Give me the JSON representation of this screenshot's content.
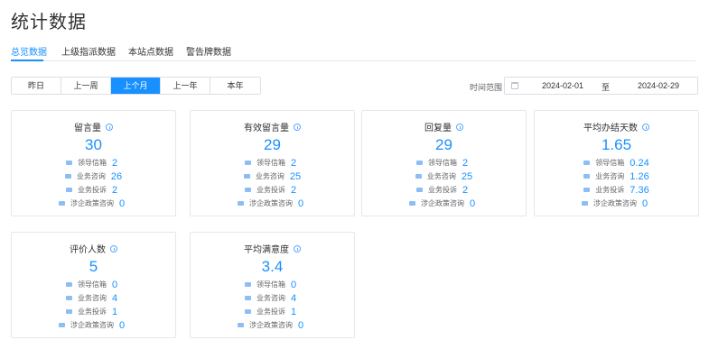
{
  "page_title": "统计数据",
  "tabs": [
    {
      "label": "总览数据",
      "active": true
    },
    {
      "label": "上级指派数据",
      "active": false
    },
    {
      "label": "本站点数据",
      "active": false
    },
    {
      "label": "警告牌数据",
      "active": false
    }
  ],
  "range_buttons": [
    "昨日",
    "上一周",
    "上个月",
    "上一年",
    "本年"
  ],
  "range_selected": "上个月",
  "time_range": {
    "label": "时间范围",
    "start": "2024-02-01",
    "separator": "至",
    "end": "2024-02-29"
  },
  "colors": {
    "accent": "#1890ff",
    "border": "#e4e7ed",
    "text": "#303133"
  },
  "row_labels": [
    "领导信箱",
    "业务咨询",
    "业务投诉",
    "涉企政策咨询"
  ],
  "cards": [
    {
      "title": "留言量",
      "value": "30",
      "rows": [
        "2",
        "26",
        "2",
        "0"
      ]
    },
    {
      "title": "有效留言量",
      "value": "29",
      "rows": [
        "2",
        "25",
        "2",
        "0"
      ]
    },
    {
      "title": "回复量",
      "value": "29",
      "rows": [
        "2",
        "25",
        "2",
        "0"
      ]
    },
    {
      "title": "平均办结天数",
      "value": "1.65",
      "rows": [
        "0.24",
        "1.26",
        "7.36",
        "0"
      ]
    },
    {
      "title": "评价人数",
      "value": "5",
      "rows": [
        "0",
        "4",
        "1",
        "0"
      ]
    },
    {
      "title": "平均满意度",
      "value": "3.4",
      "rows": [
        "0",
        "4",
        "1",
        "0"
      ]
    }
  ]
}
